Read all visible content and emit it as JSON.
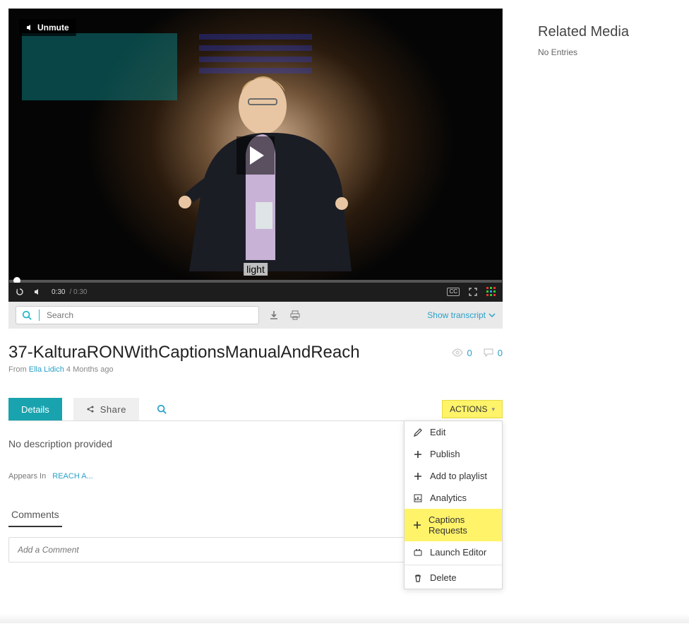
{
  "player": {
    "unmute_label": "Unmute",
    "caption_word": "light",
    "current_time": "0:30",
    "duration": "/ 0:30"
  },
  "transcript_bar": {
    "search_placeholder": "Search",
    "show_transcript": "Show transcript"
  },
  "title": "37-KalturaRONWithCaptionsManualAndReach",
  "byline": {
    "prefix": "From ",
    "author": "Ella Lidich",
    "when": " 4 Months ago"
  },
  "stats": {
    "views": "0",
    "comments": "0"
  },
  "tabs": {
    "details": "Details",
    "share": "Share"
  },
  "actions": {
    "button": "ACTIONS",
    "items": [
      {
        "icon": "pencil",
        "label": "Edit"
      },
      {
        "icon": "plus",
        "label": "Publish"
      },
      {
        "icon": "plus",
        "label": "Add to playlist"
      },
      {
        "icon": "chart",
        "label": "Analytics"
      },
      {
        "icon": "plus",
        "label": "Captions Requests",
        "highlight": true
      },
      {
        "icon": "editor",
        "label": "Launch Editor"
      },
      {
        "icon": "trash",
        "label": "Delete",
        "sep_before": true
      }
    ]
  },
  "description": "No description provided",
  "appears_in": {
    "label": "Appears In",
    "link": "REACH A..."
  },
  "comments": {
    "tab": "Comments",
    "placeholder": "Add a Comment"
  },
  "sidebar": {
    "title": "Related Media",
    "empty": "No Entries"
  }
}
